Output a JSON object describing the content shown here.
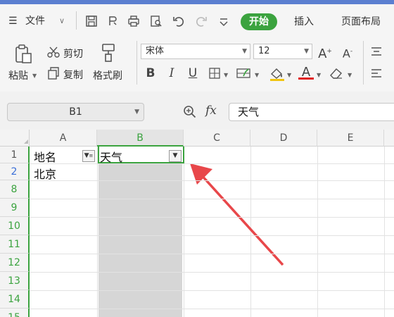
{
  "menu": {
    "file_label": "文件",
    "tabs": [
      {
        "label": "开始",
        "active": true
      },
      {
        "label": "插入",
        "active": false
      },
      {
        "label": "页面布局",
        "active": false
      }
    ]
  },
  "ribbon": {
    "paste_label": "粘贴",
    "cut_label": "剪切",
    "copy_label": "复制",
    "format_painter_label": "格式刷",
    "font_name": "宋体",
    "font_size": "12"
  },
  "formula_bar": {
    "name_box": "B1",
    "fx_label": "fx",
    "content": "天气"
  },
  "grid": {
    "columns": [
      "A",
      "B",
      "C",
      "D",
      "E"
    ],
    "selected_column": "B",
    "rows": [
      {
        "num": "1",
        "a": "地名",
        "b": "天气"
      },
      {
        "num": "2",
        "a": "北京",
        "b": ""
      },
      {
        "num": "8",
        "a": "",
        "b": ""
      },
      {
        "num": "9",
        "a": "",
        "b": ""
      },
      {
        "num": "10",
        "a": "",
        "b": ""
      },
      {
        "num": "11",
        "a": "",
        "b": ""
      },
      {
        "num": "12",
        "a": "",
        "b": ""
      },
      {
        "num": "13",
        "a": "",
        "b": ""
      },
      {
        "num": "14",
        "a": "",
        "b": ""
      },
      {
        "num": "15",
        "a": "",
        "b": ""
      }
    ]
  },
  "colors": {
    "accent_green": "#3ba33f",
    "arrow_red": "#e8474a",
    "filtered_column_gray": "#d6d6d6"
  }
}
